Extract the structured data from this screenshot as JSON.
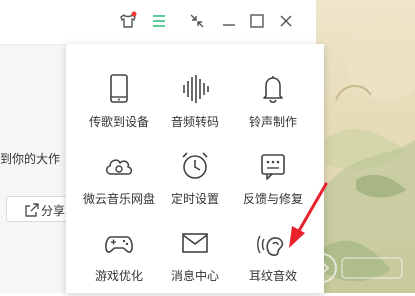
{
  "colors": {
    "accent": "#31c27c",
    "badge": "#e93a2e",
    "arrow": "#e8212b",
    "text": "#333333"
  },
  "titlebar": {
    "icons": [
      "skin-icon",
      "menu-icon",
      "mini-mode-icon",
      "minimize-icon",
      "maximize-icon",
      "close-icon"
    ]
  },
  "main": {
    "partial_text": "到你的大作",
    "share_label": "分享"
  },
  "menu": {
    "items": [
      {
        "label": "传歌到设备",
        "icon": "phone-icon"
      },
      {
        "label": "音频转码",
        "icon": "sound-wave-icon"
      },
      {
        "label": "铃声制作",
        "icon": "bell-icon"
      },
      {
        "label": "微云音乐网盘",
        "icon": "cloud-icon"
      },
      {
        "label": "定时设置",
        "icon": "alarm-clock-icon"
      },
      {
        "label": "反馈与修复",
        "icon": "feedback-icon"
      },
      {
        "label": "游戏优化",
        "icon": "gamepad-icon"
      },
      {
        "label": "消息中心",
        "icon": "mail-icon"
      },
      {
        "label": "耳纹音效",
        "icon": "ear-icon"
      }
    ]
  }
}
